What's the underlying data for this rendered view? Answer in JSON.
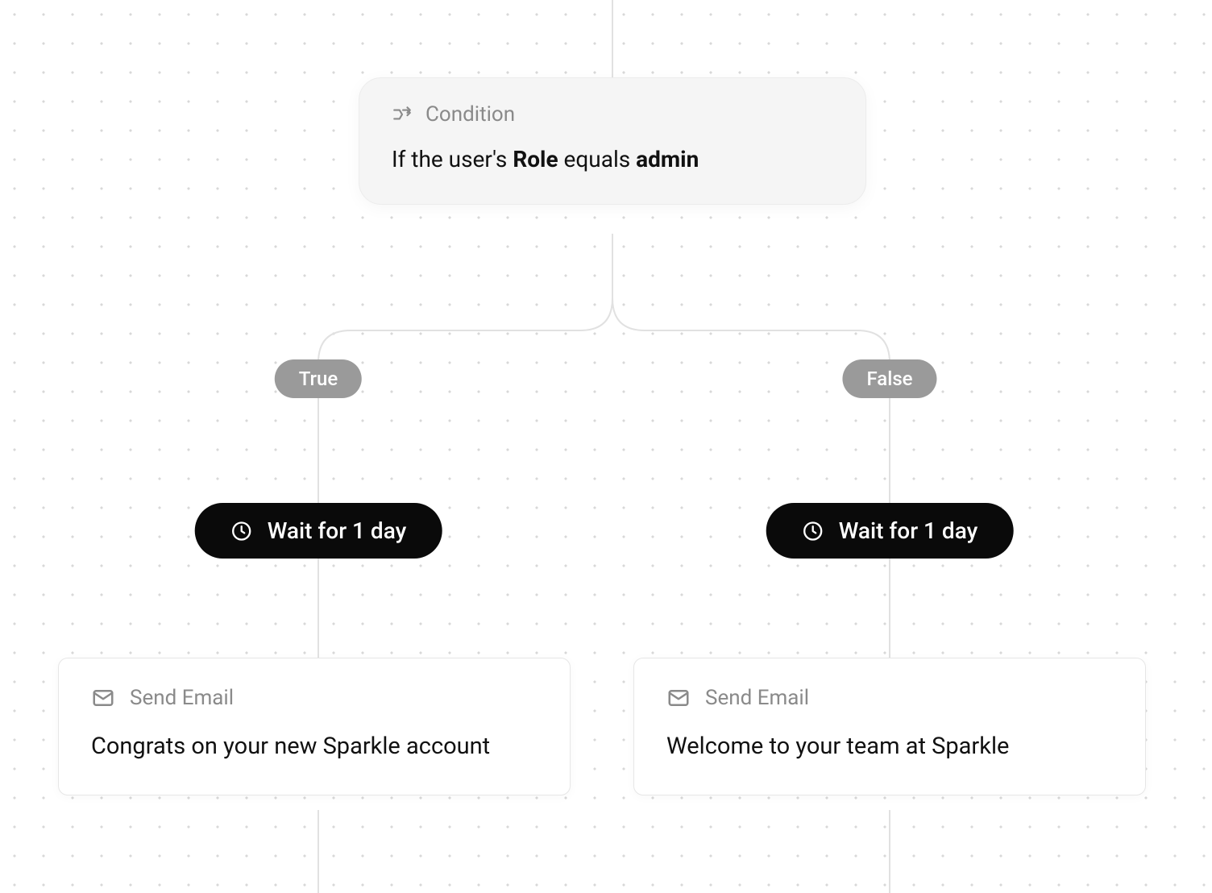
{
  "condition": {
    "type_label": "Condition",
    "prefix": "If the user's ",
    "field": "Role",
    "operator": " equals ",
    "value": "admin"
  },
  "branches": {
    "true": {
      "label": "True",
      "wait": {
        "label": "Wait for 1 day"
      },
      "email": {
        "type_label": "Send Email",
        "subject": "Congrats on your new Sparkle account"
      }
    },
    "false": {
      "label": "False",
      "wait": {
        "label": "Wait for 1 day"
      },
      "email": {
        "type_label": "Send Email",
        "subject": "Welcome to your team at Sparkle"
      }
    }
  }
}
